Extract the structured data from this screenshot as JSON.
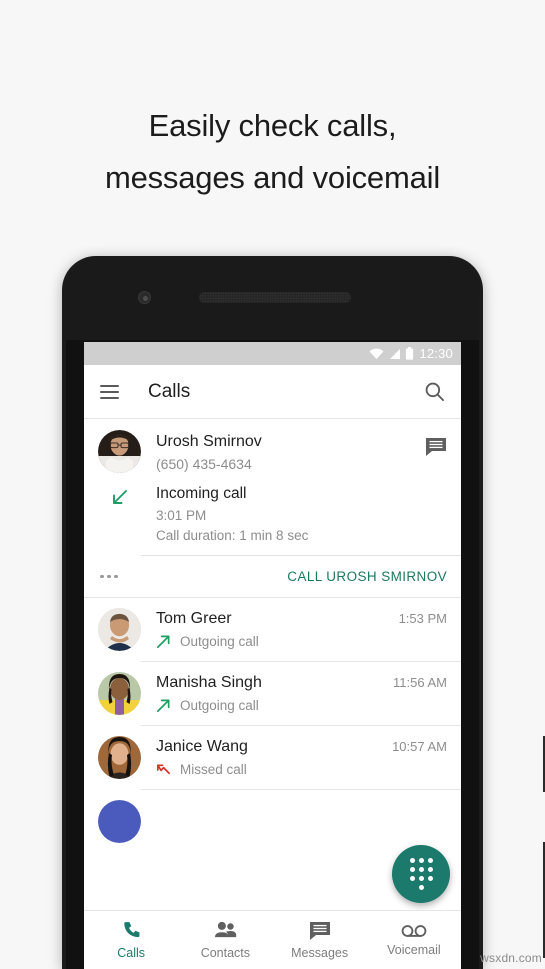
{
  "headline": {
    "line1": "Easily check calls,",
    "line2": "messages and voicemail"
  },
  "colors": {
    "accent_teal": "#1b7a6b",
    "action_green": "#1b7a5e",
    "incoming_green": "#1e9e63",
    "missed_red": "#d93025",
    "status_bar": "#cfcfcf",
    "text_primary": "#1f1f1f",
    "text_secondary": "#8d8d8d"
  },
  "status_bar": {
    "time": "12:30",
    "icons": [
      "wifi-icon",
      "signal-icon",
      "battery-icon"
    ]
  },
  "app_bar": {
    "menu_icon": "hamburger-menu-icon",
    "title": "Calls",
    "search_icon": "search-icon"
  },
  "expanded_call": {
    "avatar": "contact-avatar-urosh",
    "name": "Urosh Smirnov",
    "phone": "(650) 435-4634",
    "message_icon": "message-icon",
    "direction_icon": "incoming-call-arrow-icon",
    "detail_title": "Incoming call",
    "detail_time": "3:01 PM",
    "detail_duration": "Call duration: 1 min 8 sec",
    "overflow_icon": "more-options-icon",
    "action_label": "CALL UROSH SMIRNOV"
  },
  "call_list": [
    {
      "name": "Tom Greer",
      "time": "1:53 PM",
      "type": "Outgoing call",
      "direction": "outgoing",
      "avatar": "contact-avatar-tom"
    },
    {
      "name": "Manisha Singh",
      "time": "11:56 AM",
      "type": "Outgoing call",
      "direction": "outgoing",
      "avatar": "contact-avatar-manisha"
    },
    {
      "name": "Janice Wang",
      "time": "10:57 AM",
      "type": "Missed call",
      "direction": "missed",
      "avatar": "contact-avatar-janice"
    }
  ],
  "fab": {
    "icon": "dialpad-icon",
    "color": "#1b7a6b"
  },
  "bottom_nav": [
    {
      "label": "Calls",
      "icon": "phone-icon",
      "active": true
    },
    {
      "label": "Contacts",
      "icon": "people-icon",
      "active": false
    },
    {
      "label": "Messages",
      "icon": "message-icon",
      "active": false
    },
    {
      "label": "Voicemail",
      "icon": "voicemail-icon",
      "active": false
    }
  ],
  "watermark": "wsxdn.com"
}
